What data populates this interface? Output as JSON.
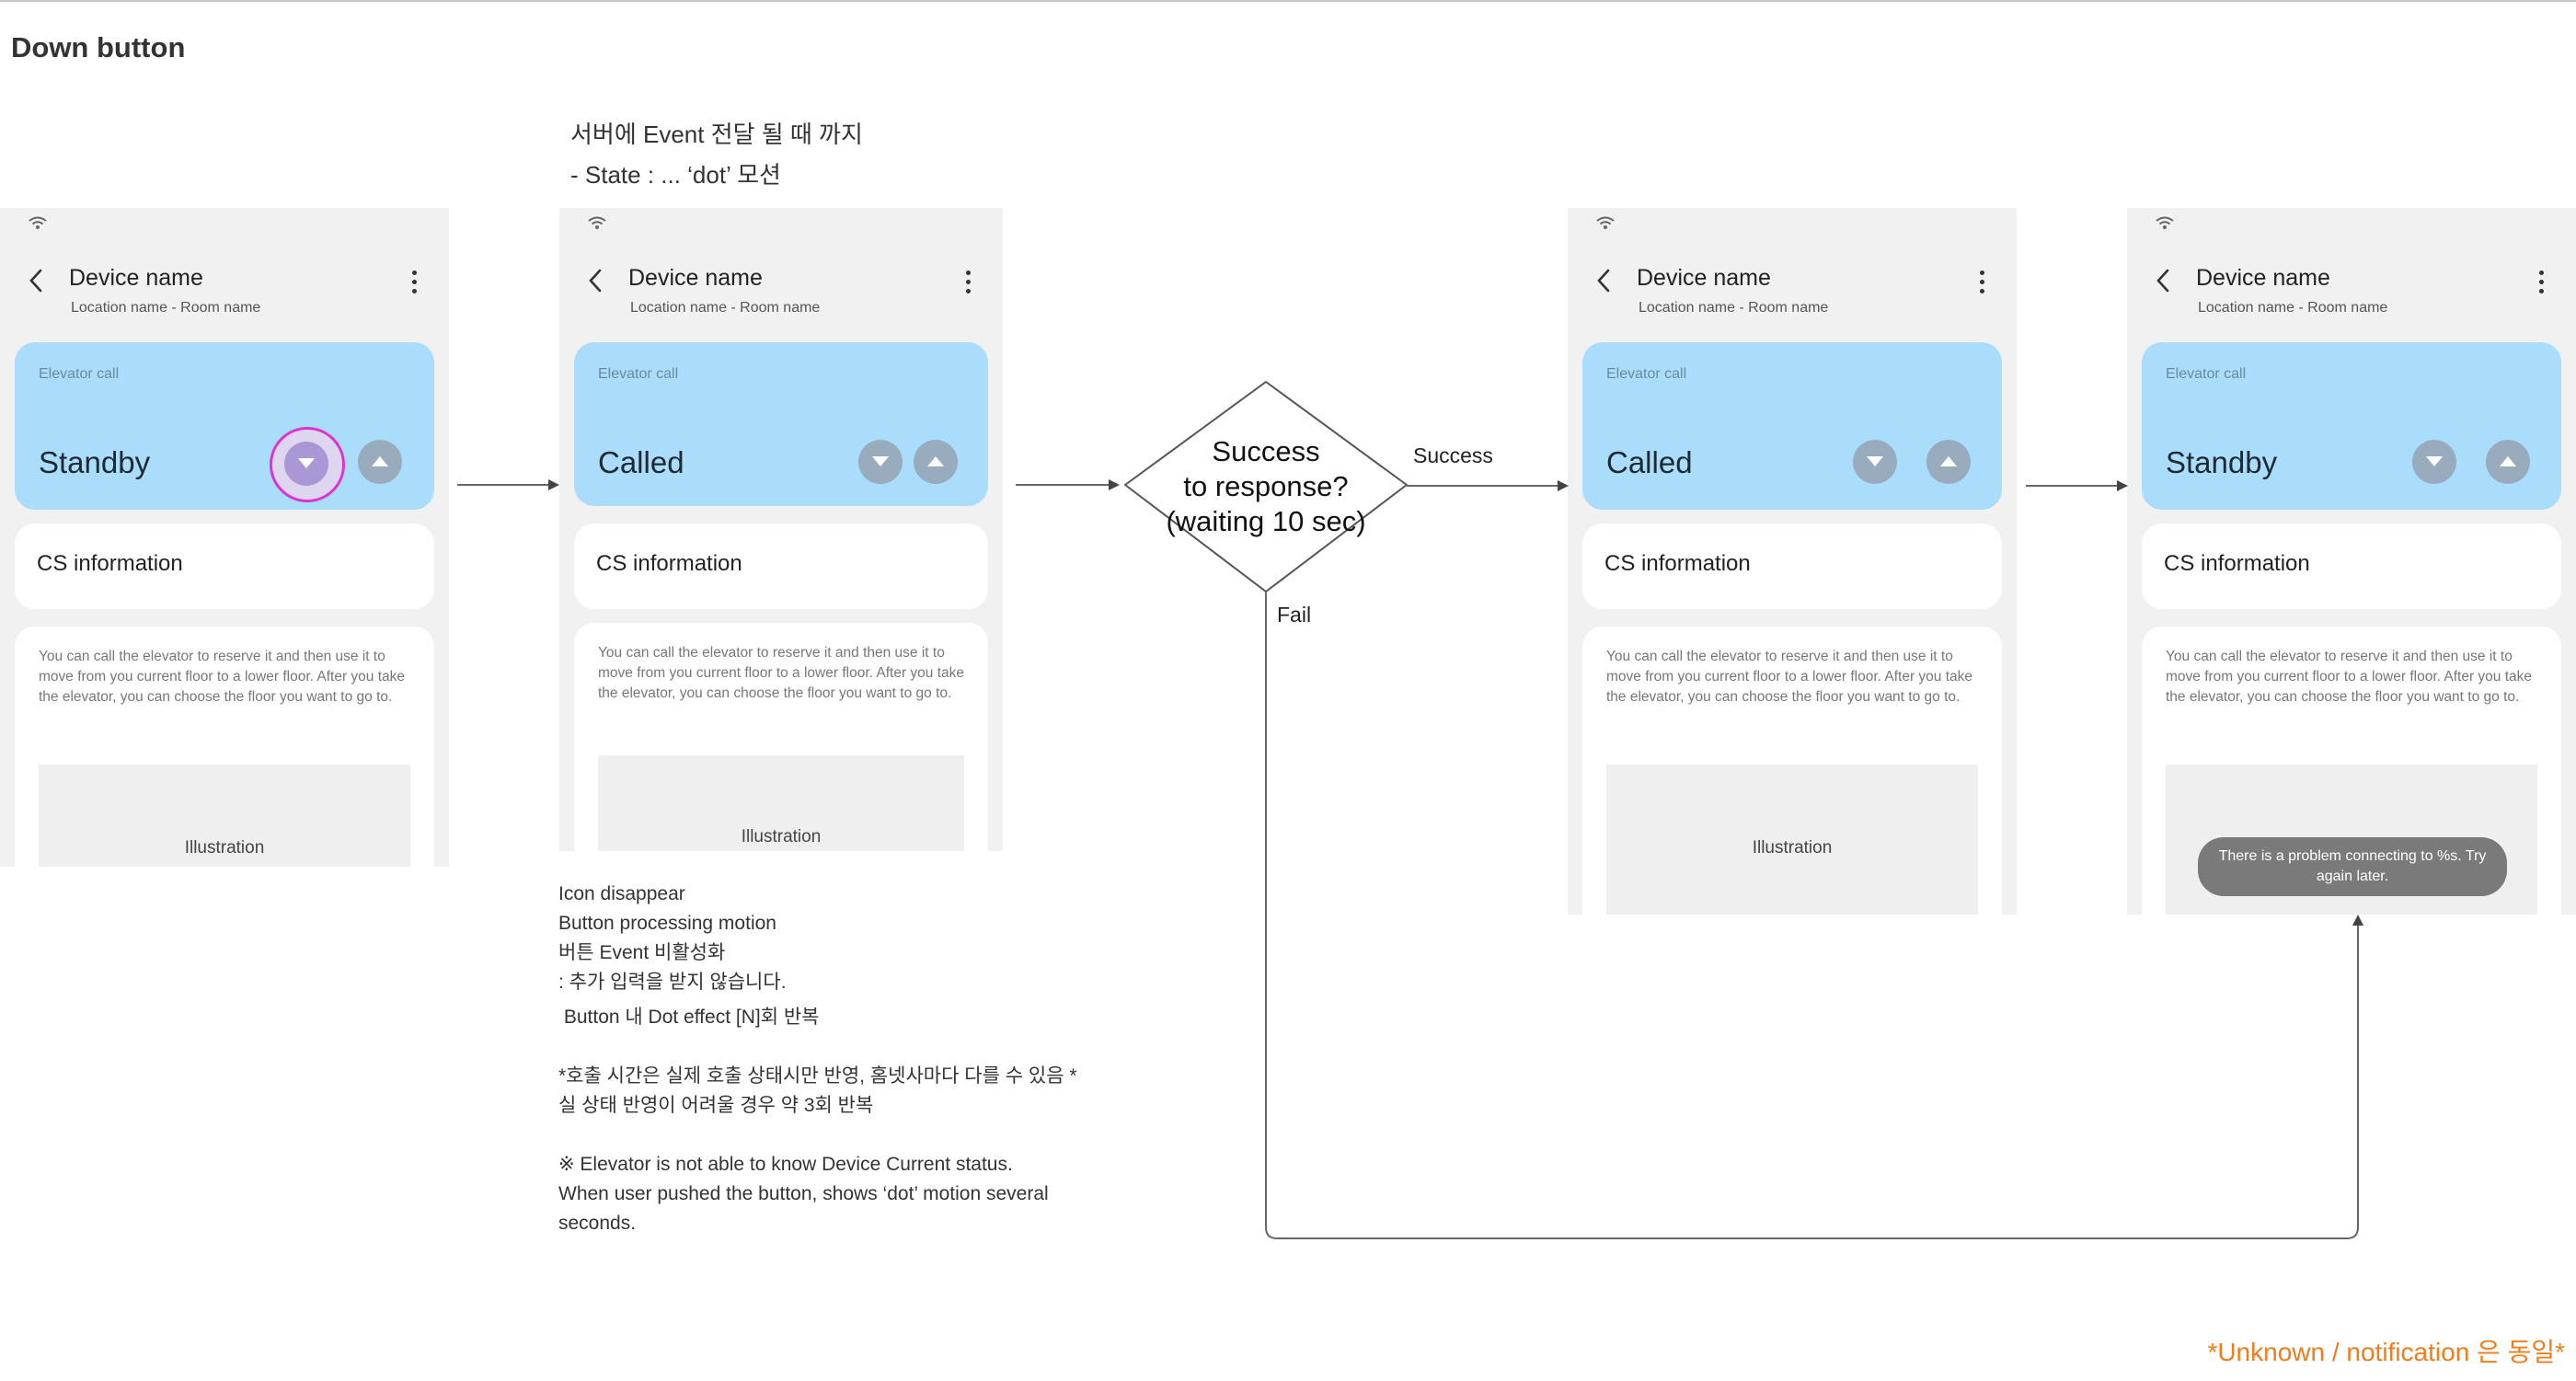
{
  "page_title": "Down button",
  "note_top": [
    "서버에 Event 전달 될 때 까지",
    "- State : ... ‘dot’ 모션"
  ],
  "device": {
    "name": "Device name",
    "location": "Location name - Room name",
    "elevator_label": "Elevator call",
    "cs_label": "CS information",
    "info_text": "You can call the elevator to reserve it and then use it to move from you current floor to a lower floor. After you take the elevator, you can choose the floor you want to go to.",
    "illustration": "Illustration"
  },
  "screens": [
    {
      "state": "Standby",
      "pressed": "down"
    },
    {
      "state": "Called"
    },
    {
      "state": "Called"
    },
    {
      "state": "Standby",
      "toast": "There is a problem connecting to %s. Try again later."
    }
  ],
  "decision": {
    "line1": "Success",
    "line2": "to response?",
    "line3": "(waiting 10 sec)",
    "success_label": "Success",
    "fail_label": "Fail"
  },
  "description_lines": [
    "Icon disappear",
    "Button processing motion",
    "버튼 Event 비활성화",
    ": 추가 입력을 받지 않습니다.",
    "",
    " Button 내 Dot effect [N]회 반복",
    "",
    "*호출 시간은 실제 호출 상태시만 반영, 홈넷사마다 다를 수 있음 *",
    "실 상태 반영이 어려울 경우 약 3회 반복",
    "",
    "※ Elevator is not able to know Device Current status.",
    "When user pushed the button, shows ‘dot’ motion several",
    "seconds."
  ],
  "footnote": "*Unknown / notification 은 동일*",
  "colors": {
    "card_blue": "#aadcfc",
    "round_button": "#98acbe",
    "press_ring": "#dd33d2",
    "footnote": "#f07d1a",
    "toast": "#7a7a7a"
  }
}
